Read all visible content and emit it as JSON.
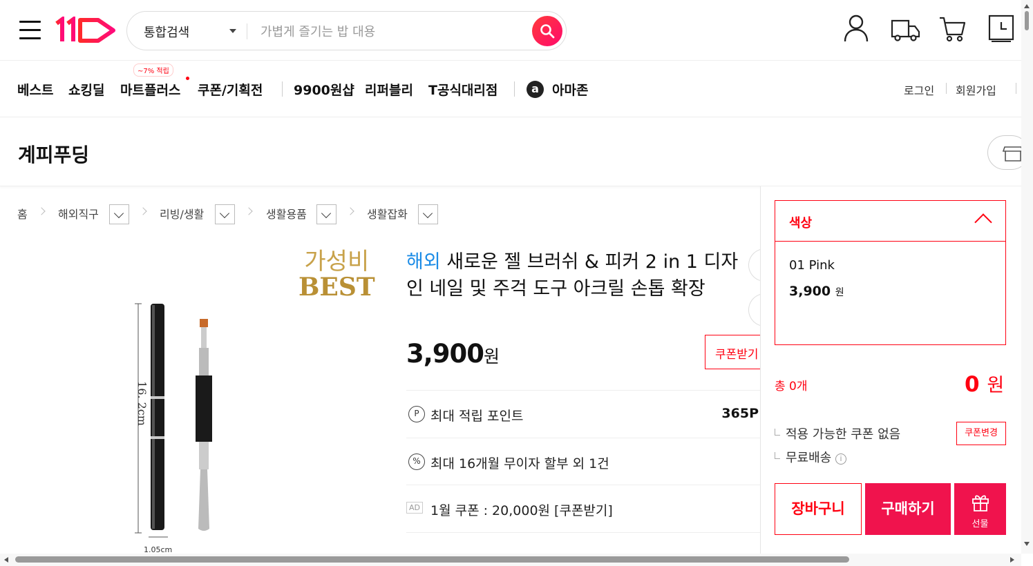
{
  "header": {
    "search": {
      "scope": "통합검색",
      "placeholder": "가볍게 즐기는 밥 대용"
    },
    "icons": [
      "menu-icon",
      "user-icon",
      "delivery-truck-icon",
      "cart-icon",
      "recent-view-icon"
    ]
  },
  "gnb": {
    "items": [
      {
        "label": "베스트"
      },
      {
        "label": "쇼킹딜"
      },
      {
        "label": "마트플러스",
        "badge": "~7% 적립"
      },
      {
        "label": "쿠폰/기획전"
      },
      {
        "label": "9900원샵"
      },
      {
        "label": "리퍼블리"
      },
      {
        "label": "T공식대리점"
      },
      {
        "label": "아마존"
      }
    ],
    "login": "로그인",
    "signup": "회원가입"
  },
  "seller": {
    "name": "계피푸딩"
  },
  "breadcrumb": [
    "홈",
    "해외직구",
    "리빙/생활",
    "생활용품",
    "생활잡화"
  ],
  "product": {
    "badge_line1": "가성비",
    "badge_line2": "BEST",
    "tag": "해외",
    "title": "새로운 젤 브러쉬 & 피커 2 in 1 디자인 네일 및 주걱 도구 아크릴 손톱 확장",
    "price": "3,900",
    "price_unit": "원",
    "coupon_button": "쿠폰받기",
    "image_dimension_length": "16. 2cm",
    "image_dimension_width": "1.05cm",
    "info": {
      "points_label": "최대 적립 포인트",
      "points_value": "365P",
      "installment": "최대 16개월 무이자 할부 외 1건",
      "ad_tag": "AD",
      "ad_coupon": "1월 쿠폰 : 20,000원 [쿠폰받기]"
    }
  },
  "panel": {
    "option_label": "색상",
    "option_name": "01 Pink",
    "option_price": "3,900",
    "option_price_unit": "원",
    "total_label": "총 0개",
    "total_value": "0",
    "total_unit": "원",
    "coupon_note": "적용 가능한 쿠폰 없음",
    "coupon_change": "쿠폰변경",
    "shipping": "무료배송",
    "cart_button": "장바구니",
    "buy_button": "구매하기",
    "gift_button": "선물"
  },
  "colors": {
    "accent": "#f0134d",
    "tag_blue": "#1a8be6",
    "gold": "#c8a24a"
  }
}
